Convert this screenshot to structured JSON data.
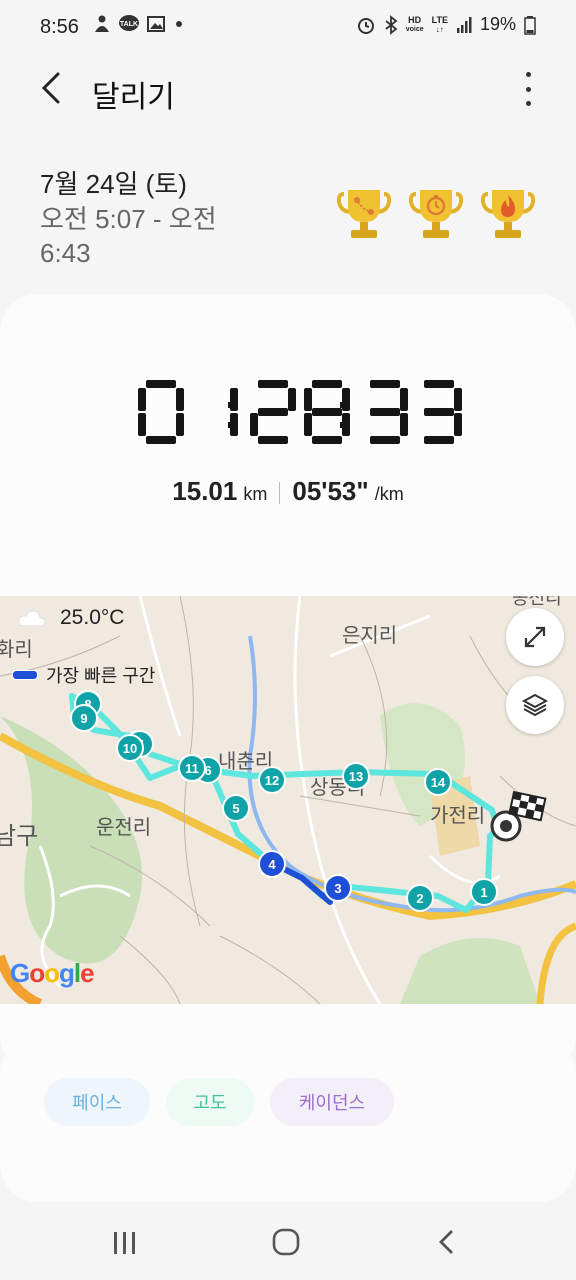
{
  "status": {
    "time": "8:56",
    "talk": "TALK",
    "hd": "HD",
    "voice": "voice",
    "lte": "LTE",
    "battery": "19%"
  },
  "appbar": {
    "title": "달리기"
  },
  "workout": {
    "date": "7월 24일 (토)",
    "time_range": "오전 5:07 - 오전 6:43",
    "duration_digits": [
      "0",
      "1",
      "2",
      "8",
      "3",
      "3"
    ],
    "distance": "15.01",
    "distance_unit": "km",
    "pace": "05'53\"",
    "pace_unit": "/km"
  },
  "trophies": [
    "distance-trophy-icon",
    "timer-trophy-icon",
    "calorie-trophy-icon"
  ],
  "map": {
    "temperature": "25.0°C",
    "legend_label": "가장 빠른 구간",
    "attribution": "Google",
    "place_labels": [
      "은지리",
      "남구",
      "운전리",
      "가전리",
      "화리",
      "상동리",
      "내춘리",
      "공전리"
    ],
    "route_markers": [
      "1",
      "2",
      "3",
      "4",
      "5",
      "6",
      "7",
      "8",
      "9",
      "10",
      "11",
      "12",
      "13",
      "14"
    ],
    "colors": {
      "route": "#5ce6de",
      "fast_segment": "#1f4fd6",
      "marker": "#0fa3a8"
    }
  },
  "tabs": [
    "페이스",
    "고도",
    "케이던스"
  ]
}
